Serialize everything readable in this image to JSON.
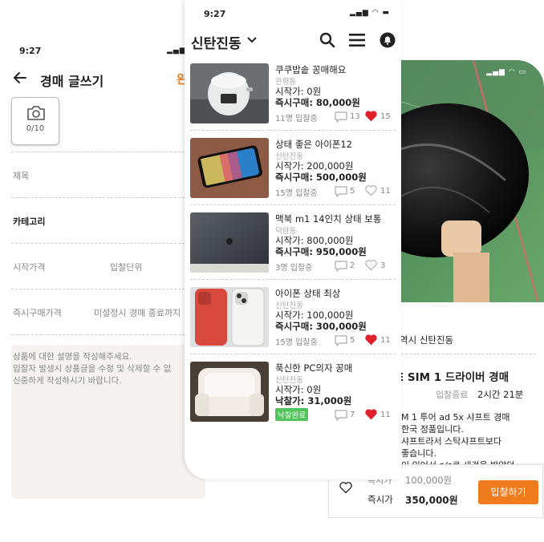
{
  "write": {
    "time": "9:27",
    "title": "경매 글쓰기",
    "done_label": "완",
    "photo_count": "0/10",
    "title_field": "제목",
    "category": "카테고리",
    "start_price": "시작가격",
    "bid_unit": "입찰단위",
    "buy_now_price": "즉시구매가격",
    "no_set_end": "미설정시 경매 종료까지",
    "description_lines": [
      "상품에 대한 설명을 작성해주세요.",
      "입찰자 발생시 상품글을 수정 및 삭제할 수 없",
      "신중하게 작성하시기 바랍니다."
    ]
  },
  "list": {
    "time": "9:27",
    "location": "신탄진동",
    "items": [
      {
        "name": "쿠쿠밥솥 꽁매해요",
        "area": "관평동",
        "start": "시작가: 0원",
        "buy": "즉시구매: 80,000원",
        "bids": "11명 입찰중",
        "comments": "13",
        "likes": "15",
        "liked": true
      },
      {
        "name": "상태 좋은 아이폰12",
        "area": "신탄진동",
        "start": "시작가: 200,000원",
        "buy": "즉시구매: 500,000원",
        "bids": "15명 입찰중",
        "comments": "5",
        "likes": "11",
        "liked": false
      },
      {
        "name": "맥북 m1 14인치 상태 보통",
        "area": "덕암동",
        "start": "시작가: 800,000원",
        "buy": "즉시구매: 950,000원",
        "bids": "3명 입찰중",
        "comments": "2",
        "likes": "3",
        "liked": false
      },
      {
        "name": "아이폰 상태 최상",
        "area": "신탄진동",
        "start": "시작가: 100,000원",
        "buy": "즉시구매: 300,000원",
        "bids": "15명 입찰중",
        "comments": "5",
        "likes": "11",
        "liked": true
      },
      {
        "name": "푹신한 PC의자 꽁매",
        "area": "신탄진동",
        "start": "시작가: 0원",
        "buy": "낙찰가: 31,000원",
        "badge": "낙찰완료",
        "comments": "7",
        "likes": "11",
        "liked": true
      }
    ]
  },
  "detail": {
    "location": "역시 신탄진동",
    "title": "E SIM 1 드라이버 경매",
    "end_label": "입찰종료",
    "end_value": "2시간 21분",
    "description_lines": [
      "M 1 투어 ad 5x 샤프트 경매",
      " 한국 정품입니다.",
      "샤프트라서 스탁샤프트보다",
      "좋습니다.",
      "이 있어서 a/s로 새것을 받았던"
    ],
    "current_label": "즉시가",
    "current_value": "100,000원",
    "buy_label": "즉시가",
    "buy_value": "350,000원",
    "bid_button": "입찰하기"
  },
  "colors": {
    "accent": "#f07b1c",
    "like": "#e0202a",
    "sold_badge": "#52c35b"
  }
}
